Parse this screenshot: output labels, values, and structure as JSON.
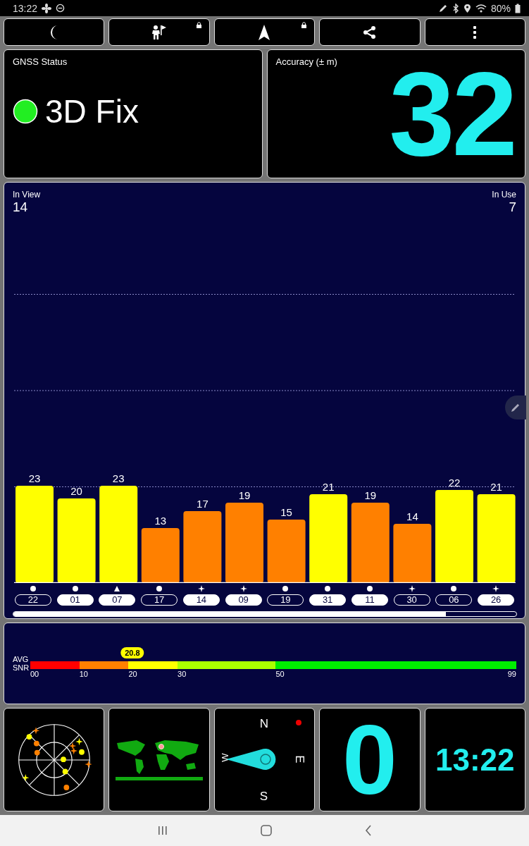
{
  "status_bar": {
    "time": "13:22",
    "battery": "80%"
  },
  "gnss_status": {
    "title": "GNSS Status",
    "fix": "3D Fix",
    "fix_ok": true
  },
  "accuracy": {
    "title": "Accuracy (± m)",
    "value": "32"
  },
  "satellites_panel": {
    "in_view_label": "In View",
    "in_view": "14",
    "in_use_label": "In Use",
    "in_use": "7",
    "chart_data": {
      "type": "bar",
      "categories": [
        "22",
        "01",
        "07",
        "17",
        "14",
        "09",
        "19",
        "31",
        "11",
        "30",
        "06",
        "26"
      ],
      "series": [
        {
          "values": [
            23,
            20,
            23,
            13,
            17,
            19,
            15,
            21,
            19,
            14,
            22,
            21
          ]
        }
      ],
      "data_labels": true
    },
    "satellites": [
      {
        "kind": "circle",
        "in_use": false,
        "color": "#ffff00"
      },
      {
        "kind": "circle",
        "in_use": true,
        "color": "#ffff00"
      },
      {
        "kind": "triangle",
        "in_use": true,
        "color": "#ffff00"
      },
      {
        "kind": "circle",
        "in_use": false,
        "color": "#ff8000"
      },
      {
        "kind": "star",
        "in_use": true,
        "color": "#ff8000"
      },
      {
        "kind": "star",
        "in_use": true,
        "color": "#ff8000"
      },
      {
        "kind": "circle",
        "in_use": false,
        "color": "#ff8000"
      },
      {
        "kind": "circle",
        "in_use": true,
        "color": "#ffff00"
      },
      {
        "kind": "circle",
        "in_use": true,
        "color": "#ff8000"
      },
      {
        "kind": "star",
        "in_use": false,
        "color": "#ff8000"
      },
      {
        "kind": "circle",
        "in_use": false,
        "color": "#ffff00"
      },
      {
        "kind": "star",
        "in_use": true,
        "color": "#ffff00"
      }
    ]
  },
  "snr": {
    "label_1": "AVG",
    "label_2": "SNR",
    "value": "20.8",
    "level": 0.21,
    "segments": [
      {
        "from": "00",
        "color": "#ff0000"
      },
      {
        "from": "10",
        "color": "#ff8000"
      },
      {
        "from": "20",
        "color": "#ffff00"
      },
      {
        "from": "30",
        "color": "#aaff00"
      },
      {
        "from": "50",
        "color": "#00ee00"
      }
    ],
    "end": "99"
  },
  "compass": {
    "north": "N",
    "east": "E",
    "south": "S",
    "west": "W"
  },
  "speed": {
    "value": "0"
  },
  "clock": {
    "time": "13:22"
  }
}
